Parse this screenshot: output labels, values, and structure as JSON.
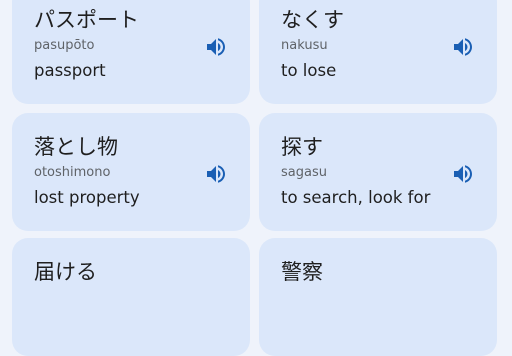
{
  "phrases": [
    {
      "japanese": "パスポート",
      "romaji": "pasupōto",
      "meaning": "passport",
      "icon": "speaker-icon"
    },
    {
      "japanese": "なくす",
      "romaji": "nakusu",
      "meaning": "to lose",
      "icon": "speaker-icon"
    },
    {
      "japanese": "落とし物",
      "romaji": "otoshimono",
      "meaning": "lost property",
      "icon": "speaker-icon"
    },
    {
      "japanese": "探す",
      "romaji": "sagasu",
      "meaning": "to search, look for",
      "icon": "speaker-icon"
    },
    {
      "japanese": "届ける"
    },
    {
      "japanese": "警察"
    }
  ],
  "colors": {
    "background": "#eff3fb",
    "card": "#dbe7fa",
    "speaker": "#1a5fb4",
    "text": "#1f1f1f",
    "romaji": "#5f6368"
  }
}
